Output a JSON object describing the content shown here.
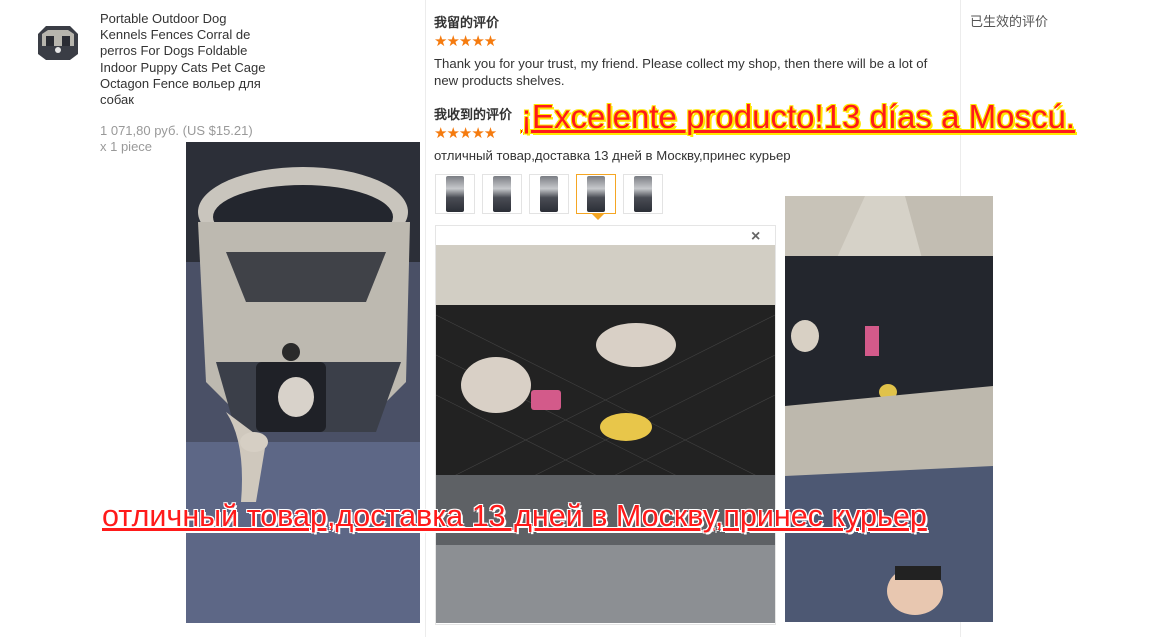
{
  "product": {
    "title": "Portable Outdoor Dog Kennels Fences Corral de perros For Dogs Foldable Indoor Puppy Cats Pet Cage Octagon Fence вольер для собак",
    "price": "1 071,80 руб. (US $15.21)",
    "quantity": "x 1 piece"
  },
  "my_review": {
    "title": "我留的评价",
    "stars": "★★★★★",
    "text": "Thank you for your trust, my friend. Please collect my shop, then there will be a lot of new products shelves."
  },
  "received_review": {
    "title": "我收到的评价",
    "stars": "★★★★★",
    "text": "отличный товар,доставка 13 дней в Москву,принес курьер"
  },
  "effective_review": {
    "title": "已生效的评价"
  },
  "viewer": {
    "close": "×"
  },
  "overlays": {
    "spanish": "¡Excelente producto!13 días a Moscú.",
    "russian": "отличный товар,доставка 13 дней в Москву,принес курьер"
  },
  "icons": {
    "close": "close-icon",
    "star": "star-icon",
    "arrow": "selected-thumb-arrow-icon"
  },
  "colors": {
    "star": "#f57b0f",
    "overlay_text": "#ff1a1a",
    "overlay_outline": "#ffe600",
    "active_thumb": "#f5a623"
  }
}
